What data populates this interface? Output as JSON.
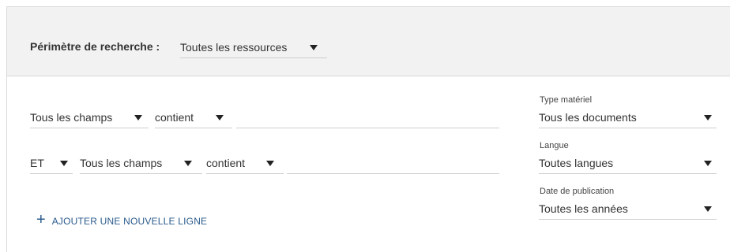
{
  "scope": {
    "label": "Périmètre de recherche :",
    "value": "Toutes les ressources"
  },
  "search_rows": [
    {
      "field": "Tous les champs",
      "operator": "contient",
      "query": ""
    },
    {
      "boolean": "ET",
      "field": "Tous les champs",
      "operator": "contient",
      "query": ""
    }
  ],
  "add_line": {
    "icon": "plus-icon",
    "label": "AJOUTER UNE NOUVELLE LIGNE"
  },
  "facets": {
    "type": {
      "label": "Type matériel",
      "value": "Tous les documents"
    },
    "language": {
      "label": "Langue",
      "value": "Toutes langues"
    },
    "date": {
      "label": "Date de publication",
      "value": "Toutes les années"
    }
  },
  "colors": {
    "accent": "#2a5a8c",
    "scope_bg": "#f2f2f2"
  }
}
